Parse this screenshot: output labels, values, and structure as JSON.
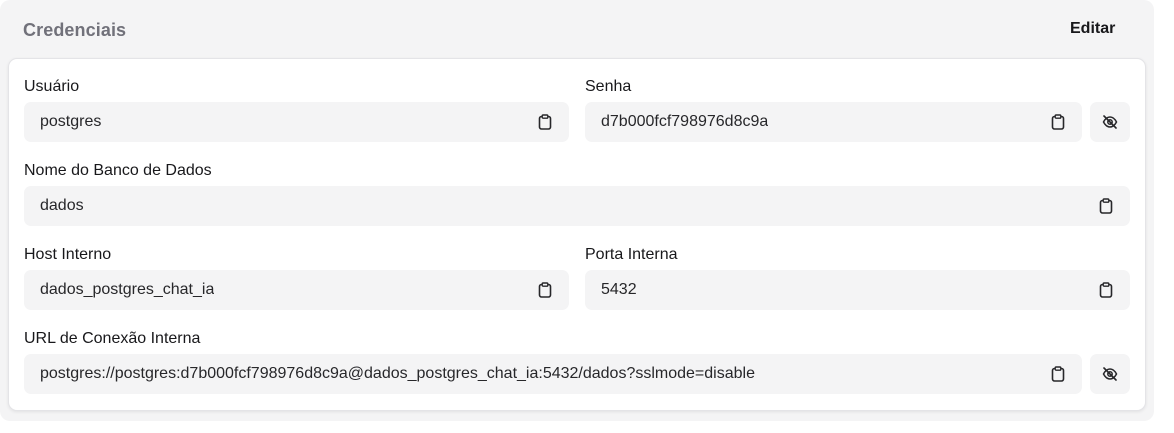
{
  "panel": {
    "title": "Credenciais",
    "edit_label": "Editar"
  },
  "fields": {
    "user": {
      "label": "Usuário",
      "value": "postgres"
    },
    "password": {
      "label": "Senha",
      "value": "d7b000fcf798976d8c9a"
    },
    "database": {
      "label": "Nome do Banco de Dados",
      "value": "dados"
    },
    "host": {
      "label": "Host Interno",
      "value": "dados_postgres_chat_ia"
    },
    "port": {
      "label": "Porta Interna",
      "value": "5432"
    },
    "url": {
      "label": "URL de Conexão Interna",
      "value": "postgres://postgres:d7b000fcf798976d8c9a@dados_postgres_chat_ia:5432/dados?sslmode=disable"
    }
  },
  "icons": {
    "copy": "clipboard-icon",
    "visibility": "eye-off-icon"
  },
  "colors": {
    "panel_bg": "#f4f4f5",
    "field_bg": "#f4f4f5",
    "title": "#71717a",
    "text": "#18181b"
  }
}
